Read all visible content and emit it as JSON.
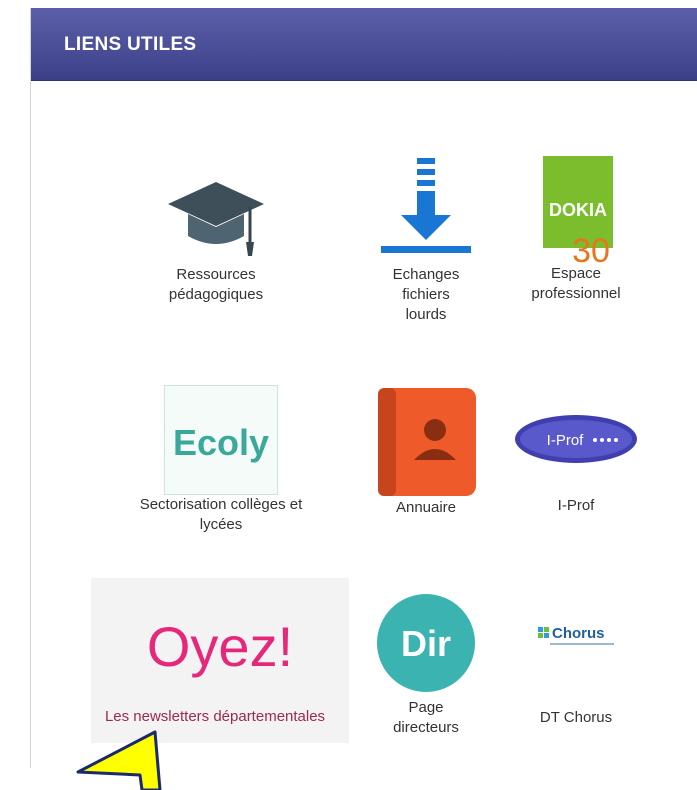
{
  "header": {
    "title": "LIENS UTILES"
  },
  "links": {
    "ressources": {
      "label_line1": "Ressources",
      "label_line2": "pédagogiques",
      "icon": "graduation-cap-icon"
    },
    "echanges": {
      "label_line1": "Echanges",
      "label_line2": "fichiers",
      "label_line3": "lourds",
      "icon": "download-icon"
    },
    "espace": {
      "label_line1": "Espace",
      "label_line2": "professionnel",
      "icon": "dokia-logo",
      "logo_text": "DOKIA",
      "logo_number": "30"
    },
    "sectorisation": {
      "label_line1": "Sectorisation collèges et",
      "label_line2": "lycées",
      "icon": "ecoly-logo",
      "logo_text": "Ecoly"
    },
    "annuaire": {
      "label": "Annuaire",
      "icon": "address-book-icon"
    },
    "iprof": {
      "label": "I-Prof",
      "icon": "iprof-logo",
      "logo_text": "I-Prof"
    },
    "oyez": {
      "icon": "oyez-banner",
      "title_text": "Oyez!",
      "subtitle_text": "Les newsletters départementales"
    },
    "directeurs": {
      "label_line1": "Page",
      "label_line2": "directeurs",
      "icon": "dir-badge",
      "badge_text": "Dir"
    },
    "chorus": {
      "label": "DT Chorus",
      "icon": "chorus-logo",
      "logo_text": "Chorus"
    }
  },
  "colors": {
    "header_bg": "#4a4f98",
    "download_blue": "#1976d2",
    "dokia_green": "#7cbd2e",
    "dokia_orange": "#e8741c",
    "annuaire_orange": "#ee5a2a",
    "dir_teal": "#3bb3b0",
    "oyez_pink": "#e6287a",
    "ecoly_teal": "#3aa99a"
  },
  "annotation": {
    "icon": "yellow-arrow-pointer"
  }
}
